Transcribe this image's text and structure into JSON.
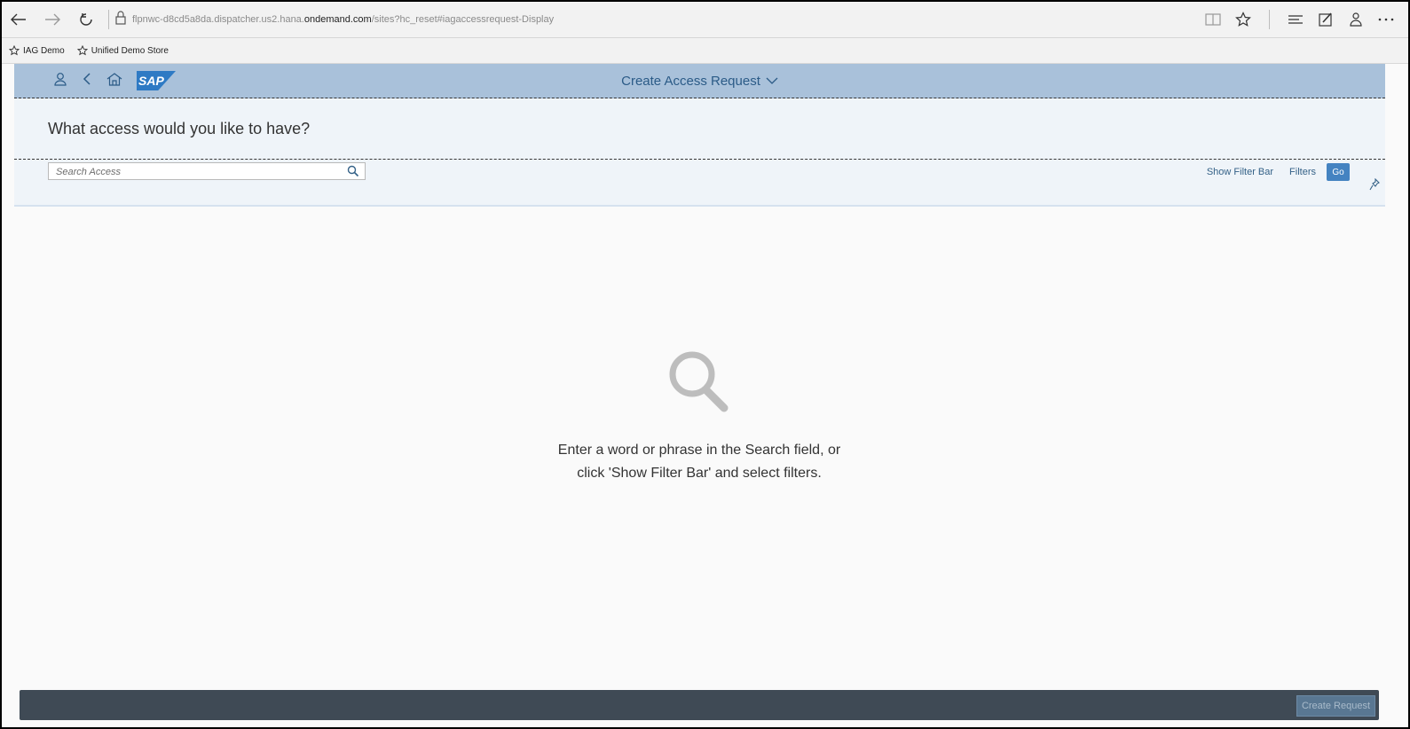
{
  "browser": {
    "url_prefix": "flpnwc-d8cd5a8da.dispatcher.us2.hana.",
    "url_domain": "ondemand.com",
    "url_suffix": "/sites?hc_reset#iagaccessrequest-Display",
    "favorites": [
      {
        "label": "IAG Demo",
        "icon": "star-icon"
      },
      {
        "label": "Unified Demo Store",
        "icon": "star-icon"
      }
    ]
  },
  "shell": {
    "title": "Create Access Request",
    "logo_text": "SAP"
  },
  "header": {
    "title": "What access would you like to have?",
    "search_placeholder": "Search Access",
    "show_filter_bar": "Show Filter Bar",
    "filters": "Filters",
    "go": "Go"
  },
  "empty_state": {
    "line1": "Enter a word or phrase in the Search field, or",
    "line2": "click 'Show Filter Bar' and select filters."
  },
  "footer": {
    "create_request": "Create Request"
  },
  "colors": {
    "shell": "#a9c1da",
    "header": "#eff4f9",
    "accent": "#4483c1",
    "footer": "#3f4a55"
  }
}
